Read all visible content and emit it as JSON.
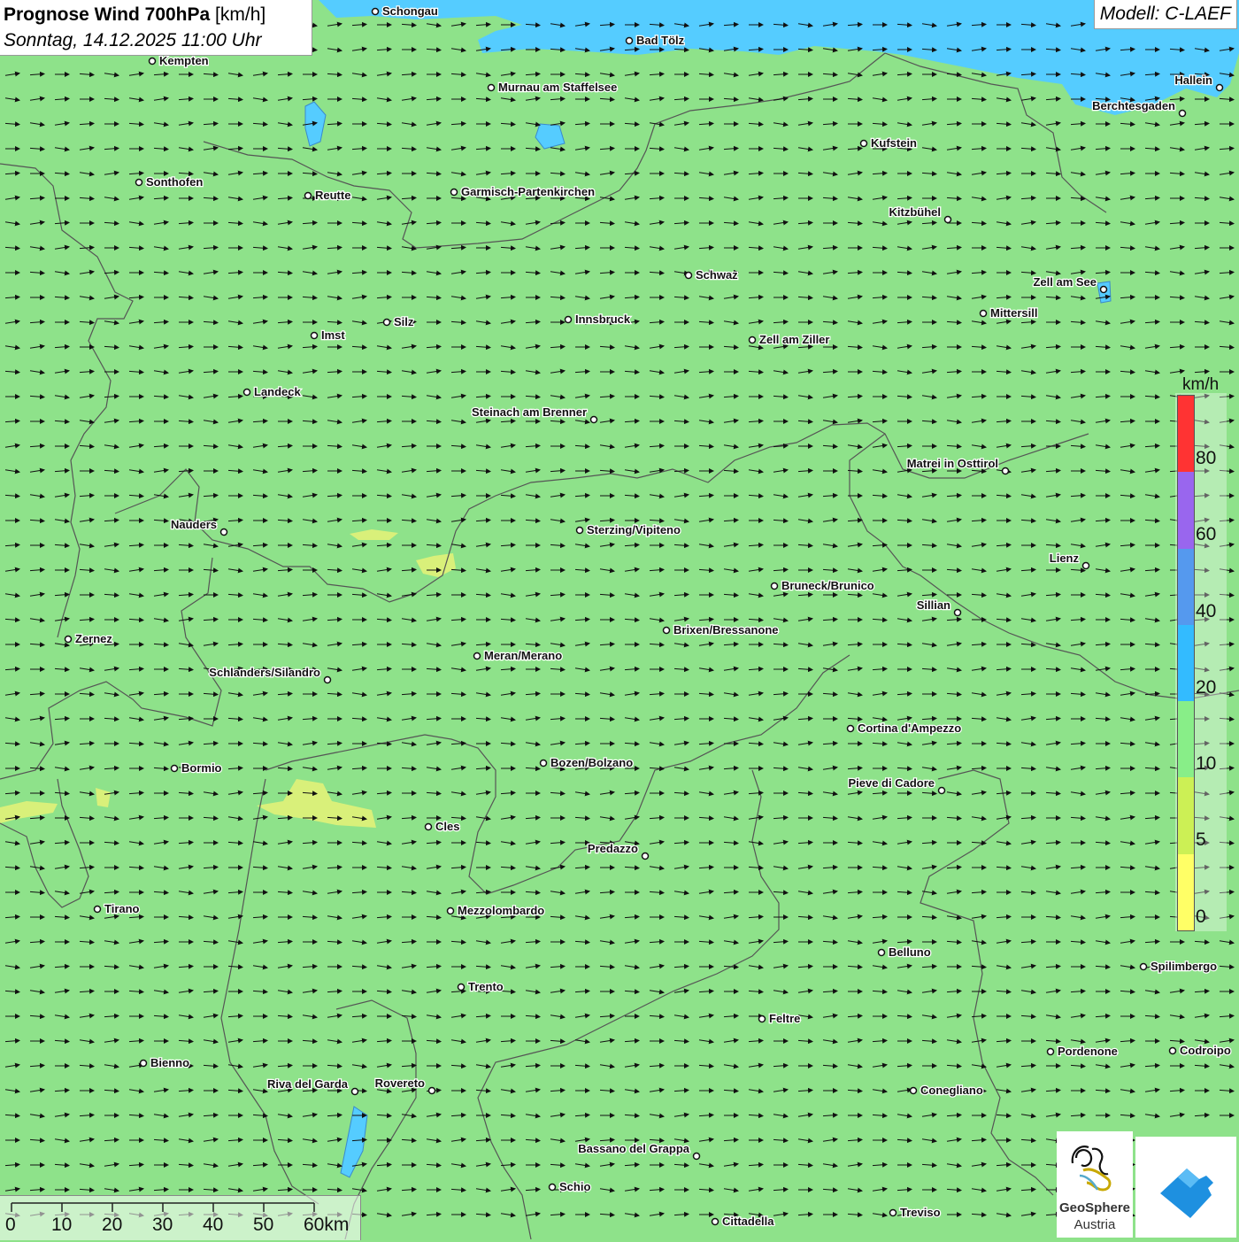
{
  "title": {
    "main": "Prognose Wind 700hPa",
    "unit": "[km/h]",
    "datetime": "Sonntag, 14.12.2025 11:00 Uhr"
  },
  "model": "Modell: C-LAEF",
  "legend": {
    "unit": "km/h",
    "labels": [
      "80",
      "60",
      "40",
      "20",
      "10",
      "5",
      "0"
    ],
    "colors": [
      "#ff3333",
      "#9966ee",
      "#5599ee",
      "#33bbff",
      "#88ee88",
      "#ccf055",
      "#ffff66"
    ]
  },
  "scalebar": {
    "labels": [
      "0",
      "10",
      "20",
      "30",
      "40",
      "50",
      "60km"
    ]
  },
  "logos": {
    "geosphere_line1": "GeoSphere",
    "geosphere_line2": "Austria"
  },
  "colors": {
    "land": "#8ee28a",
    "lake": "#55ccff",
    "yellow_patch": "#d9f07a",
    "border": "#555555"
  },
  "map": {
    "wind_direction": "east",
    "cities": [
      {
        "name": "Schongau"
      },
      {
        "name": "Bad Tölz"
      },
      {
        "name": "Kempten"
      },
      {
        "name": "Murnau am Staffelsee"
      },
      {
        "name": "Hallein"
      },
      {
        "name": "Berchtesgaden"
      },
      {
        "name": "Kufstein"
      },
      {
        "name": "Sonthofen"
      },
      {
        "name": "Reutte"
      },
      {
        "name": "Garmisch-Partenkirchen"
      },
      {
        "name": "Kitzbühel"
      },
      {
        "name": "Schwaz"
      },
      {
        "name": "Zell am See"
      },
      {
        "name": "Mittersill"
      },
      {
        "name": "Innsbruck"
      },
      {
        "name": "Silz"
      },
      {
        "name": "Imst"
      },
      {
        "name": "Zell am Ziller"
      },
      {
        "name": "Landeck"
      },
      {
        "name": "Steinach am Brenner"
      },
      {
        "name": "Matrei in Osttirol"
      },
      {
        "name": "Nauders"
      },
      {
        "name": "Sterzing/Vipiteno"
      },
      {
        "name": "Lienz"
      },
      {
        "name": "Bruneck/Brunico"
      },
      {
        "name": "Sillian"
      },
      {
        "name": "Brixen/Bressanone"
      },
      {
        "name": "Zernez"
      },
      {
        "name": "Meran/Merano"
      },
      {
        "name": "Schlanders/Silandro"
      },
      {
        "name": "Cortina d'Ampezzo"
      },
      {
        "name": "Bozen/Bolzano"
      },
      {
        "name": "Bormio"
      },
      {
        "name": "Pieve di Cadore"
      },
      {
        "name": "Cles"
      },
      {
        "name": "Predazzo"
      },
      {
        "name": "Tirano"
      },
      {
        "name": "Mezzolombardo"
      },
      {
        "name": "Belluno"
      },
      {
        "name": "Spilimbergo"
      },
      {
        "name": "Trento"
      },
      {
        "name": "Feltre"
      },
      {
        "name": "Pordenone"
      },
      {
        "name": "Codroipo"
      },
      {
        "name": "Bienno"
      },
      {
        "name": "Riva del Garda"
      },
      {
        "name": "Rovereto"
      },
      {
        "name": "Conegliano"
      },
      {
        "name": "Bassano del Grappa"
      },
      {
        "name": "Schio"
      },
      {
        "name": "Treviso"
      },
      {
        "name": "Cittadella"
      }
    ]
  }
}
